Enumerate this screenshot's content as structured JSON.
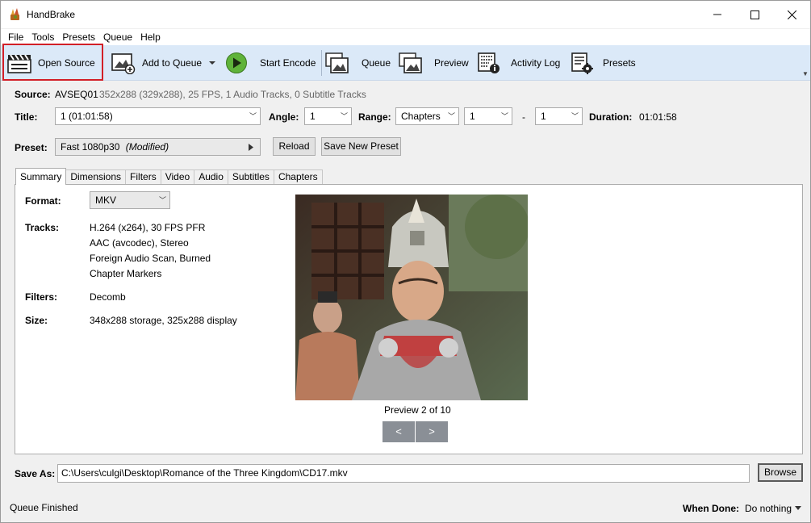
{
  "window": {
    "title": "HandBrake"
  },
  "menu": [
    "File",
    "Tools",
    "Presets",
    "Queue",
    "Help"
  ],
  "toolbar": {
    "open_source": "Open Source",
    "add_to_queue": "Add to Queue",
    "start_encode": "Start Encode",
    "queue": "Queue",
    "preview": "Preview",
    "activity_log": "Activity Log",
    "presets": "Presets"
  },
  "source": {
    "label": "Source:",
    "name": "AVSEQ01",
    "details": "352x288 (329x288), 25 FPS, 1 Audio Tracks, 0 Subtitle Tracks"
  },
  "title_row": {
    "title_label": "Title:",
    "title_value": "1  (01:01:58)",
    "angle_label": "Angle:",
    "angle_value": "1",
    "range_label": "Range:",
    "range_value": "Chapters",
    "range_start": "1",
    "range_dash": "-",
    "range_end": "1",
    "duration_label": "Duration:",
    "duration_value": "01:01:58"
  },
  "preset": {
    "label": "Preset:",
    "value": "Fast 1080p30",
    "modified": "(Modified)",
    "reload": "Reload",
    "save_new": "Save New Preset"
  },
  "tabs": [
    "Summary",
    "Dimensions",
    "Filters",
    "Video",
    "Audio",
    "Subtitles",
    "Chapters"
  ],
  "summary": {
    "format_label": "Format:",
    "format_value": "MKV",
    "tracks_label": "Tracks:",
    "tracks": [
      "H.264 (x264), 30 FPS PFR",
      "AAC (avcodec), Stereo",
      "Foreign Audio Scan, Burned",
      "Chapter Markers"
    ],
    "filters_label": "Filters:",
    "filters_value": "Decomb",
    "size_label": "Size:",
    "size_value": "348x288 storage, 325x288 display",
    "preview_caption": "Preview 2 of 10",
    "prev": "<",
    "next": ">"
  },
  "save_as": {
    "label": "Save As:",
    "path": "C:\\Users\\culgi\\Desktop\\Romance of the Three Kingdom\\CD17.mkv",
    "browse": "Browse"
  },
  "status": {
    "text": "Queue Finished",
    "when_done_label": "When Done:",
    "when_done_value": "Do nothing"
  }
}
